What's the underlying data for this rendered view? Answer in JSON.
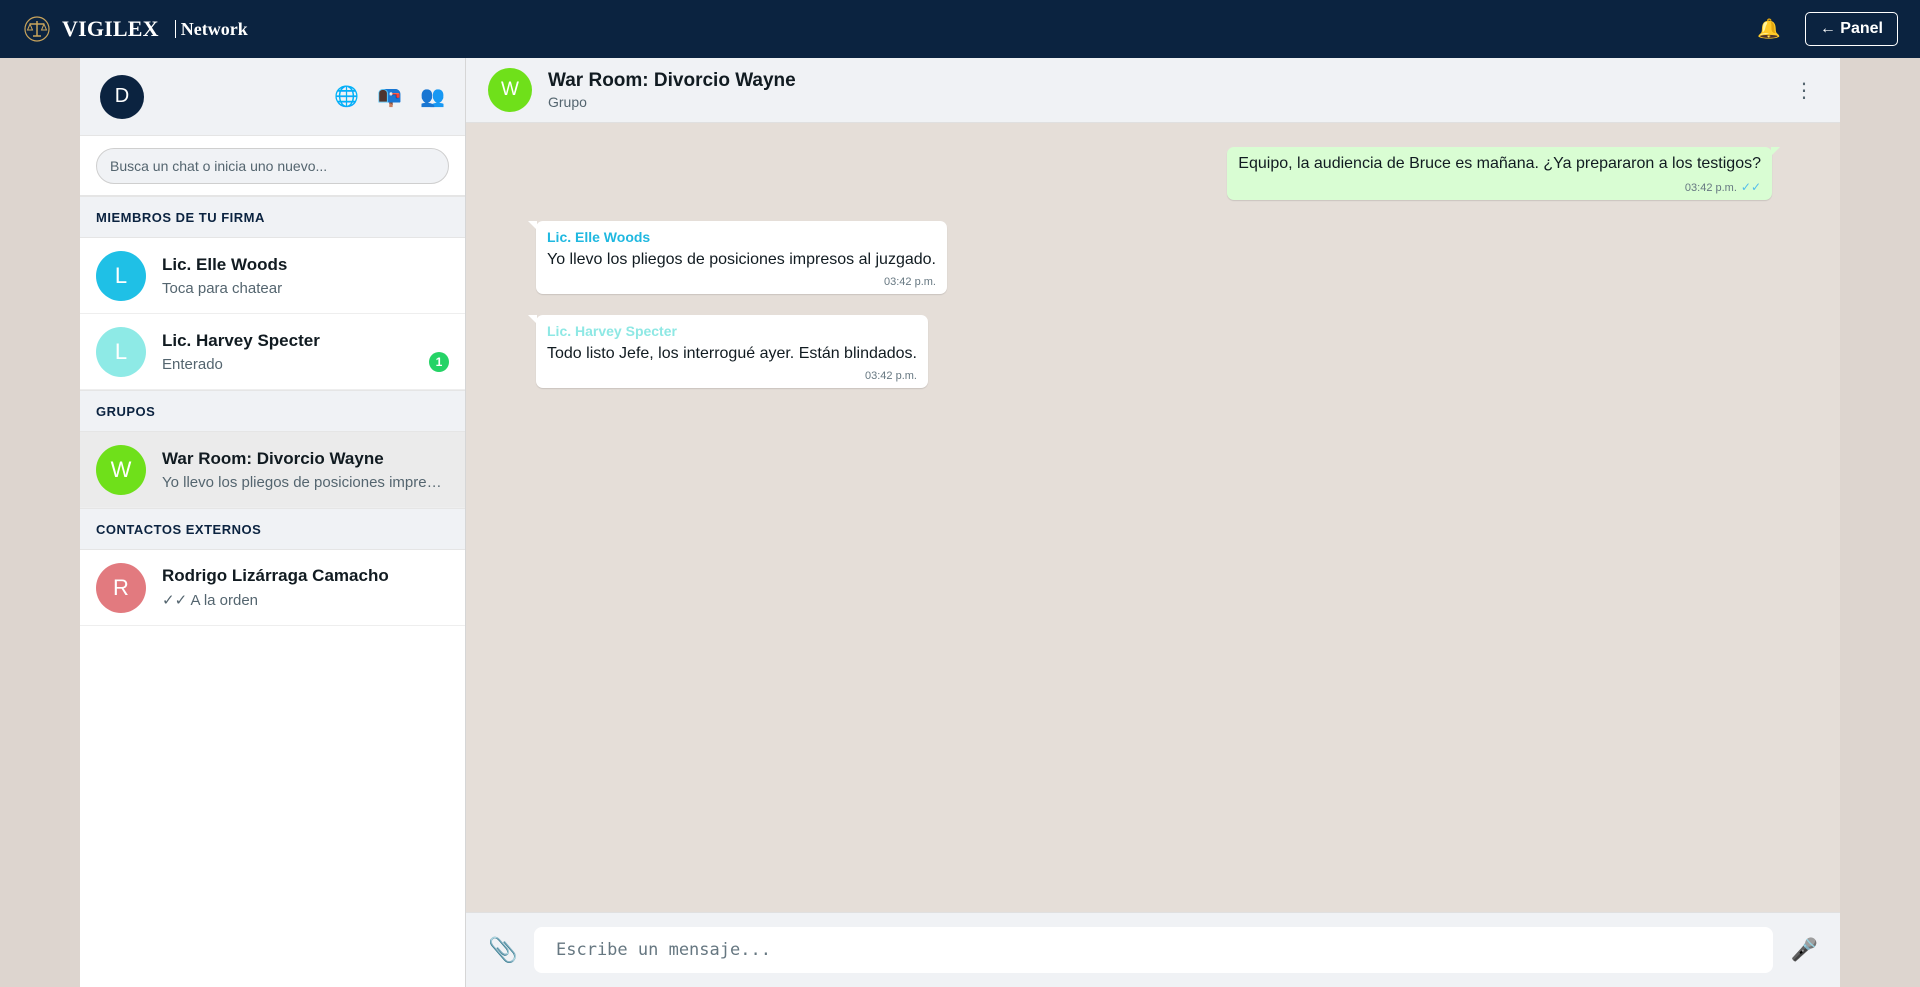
{
  "topbar": {
    "brand_name": "VIGILEX",
    "brand_sub": "Network",
    "panel_label": "← Panel"
  },
  "sidebar": {
    "my_avatar": "D",
    "search_placeholder": "Busca un chat o inicia uno nuevo...",
    "sections": {
      "members_title": "MIEMBROS DE TU FIRMA",
      "groups_title": "GRUPOS",
      "external_title": "CONTACTOS EXTERNOS"
    },
    "members": [
      {
        "initial": "L",
        "name": "Lic. Elle Woods",
        "preview": "Toca para chatear",
        "color": "#1fc0e6"
      },
      {
        "initial": "L",
        "name": "Lic. Harvey Specter",
        "preview": "Enterado",
        "color": "#8eeae6",
        "unread": "1"
      }
    ],
    "groups": [
      {
        "initial": "W",
        "name": "War Room: Divorcio Wayne",
        "preview": "Yo llevo los pliegos de posiciones impresos al juzgado.",
        "color": "#6fe01a"
      }
    ],
    "external": [
      {
        "initial": "R",
        "name": "Rodrigo Lizárraga Camacho",
        "preview": "✓✓ A la orden",
        "color": "#e27a7f"
      }
    ]
  },
  "chat": {
    "avatar": "W",
    "avatar_color": "#6fe01a",
    "title": "War Room: Divorcio Wayne",
    "subtitle": "Grupo",
    "messages": [
      {
        "dir": "out",
        "text": "Equipo, la audiencia de Bruce es mañana. ¿Ya prepararon a los testigos?",
        "time": "03:42 p.m.",
        "ticks": "✓✓"
      },
      {
        "dir": "in",
        "sender": "Lic. Elle Woods",
        "sender_color": "#1fb8e0",
        "text": "Yo llevo los pliegos de posiciones impresos al juzgado.",
        "time": "03:42 p.m."
      },
      {
        "dir": "in",
        "sender": "Lic. Harvey Specter",
        "sender_color": "#8ee8e4",
        "text": "Todo listo Jefe, los interrogué ayer. Están blindados.",
        "time": "03:42 p.m."
      }
    ],
    "composer_placeholder": "Escribe un mensaje..."
  },
  "icons": {
    "brand": "scales-icon",
    "bell": "bell-icon",
    "globe": "globe-icon",
    "mailbox": "mailbox-icon",
    "people": "people-icon",
    "menu": "kebab-menu-icon",
    "clip": "paperclip-icon",
    "mic": "microphone-icon"
  },
  "colors": {
    "navy": "#0b2340",
    "outgoing_bubble": "#d9fdd3",
    "chat_background": "#e5ded8",
    "unread_badge": "#25d366"
  }
}
